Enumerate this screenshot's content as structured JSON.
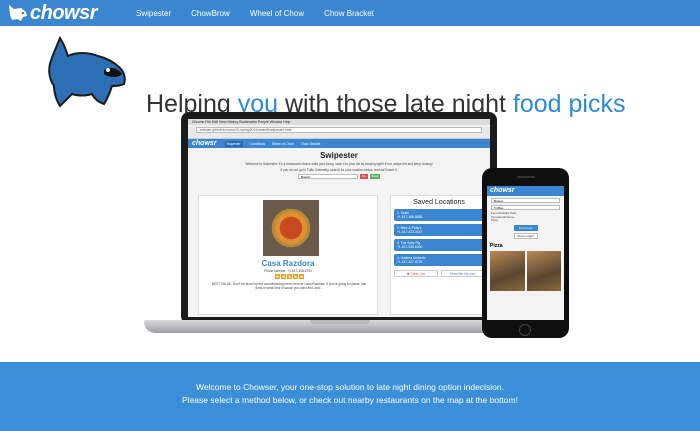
{
  "nav": {
    "logo_text": "chowsr",
    "links": [
      "Swipester",
      "ChowBrow",
      "Wheel of Chow",
      "Chow Bracket"
    ]
  },
  "hero": {
    "headline_part1": "Helping ",
    "headline_hl1": "you",
    "headline_part2": " with those late night ",
    "headline_hl2": "food picks"
  },
  "mockup": {
    "mac_menu": "Chrome  File  Edit  View  History  Bookmarks  People  Window  Help",
    "address": "erikuler.github.io/comp20-spring2015-team8/swipester.html",
    "inner_logo": "chowsr",
    "inner_links": [
      "Swipester",
      "ChowBrow",
      "Wheel of Chow",
      "Chow Bracket"
    ],
    "title": "Swipester",
    "desc1": "Welcome to Swipester. It's a restaurant choice suite your fancy, save it to your list by swiping right! If not, swipe left and keep looking!",
    "desc2": "If you do not go to Tufts University, search for your location below, and we'll save it.",
    "location_value": "Boston",
    "no_label": "No",
    "yes_label": "Save",
    "restaurant_name": "Casa Razdora",
    "restaurant_phone": "Phone Number: +1-617-338-6700",
    "stars": [
      "★",
      "★",
      "★",
      "★",
      "★"
    ],
    "restaurant_desc": "BEST VALUE. Don't be fazed by the overwhelming menu here at Casa Razdora. If you're going for pasta, just think of what kind of sauce you want first, and...",
    "saved_title": "Saved Locations",
    "saved_items": [
      "1. Sushi\n+1-617-348-8888",
      "2. Mike & Patty's\n+1-617-423-3447",
      "3. The Salty Pig\n+1-617-536-6200",
      "4. Galleria Umberto\n+1-617-227-5709"
    ],
    "clear_label": "✖ Clear List",
    "send_label": "Send Me My List"
  },
  "phone": {
    "logo_text": "chowsr",
    "location_value": "Boston",
    "radius_value": "5 Miles",
    "options": [
      "Food (Default) Value",
      "Sensational Venue",
      "Pizza"
    ],
    "find_label": "Find Food",
    "graph_label": "Show Graph",
    "section": "Pizza"
  },
  "band": {
    "line1": "Welcome to Chowser, your one-stop solution to late night dining option indecision.",
    "line2": "Please select a method below, or check out nearby restaurants on the map at the bottom!"
  }
}
